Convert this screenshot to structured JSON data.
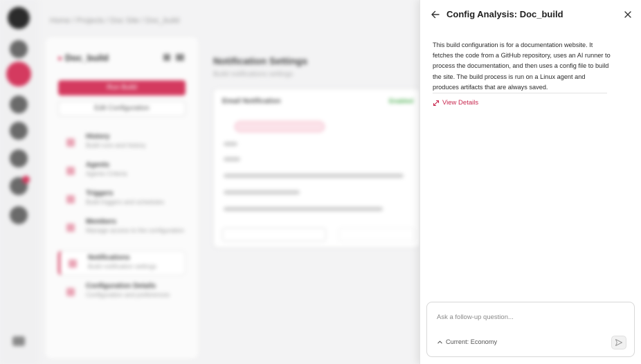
{
  "background": {
    "breadcrumb": "Home / Projects / Doc Site / Doc_build",
    "config_name": "Doc_build",
    "run_button": "Run Build",
    "edit_button": "Edit Configuration",
    "nav": [
      {
        "title": "History",
        "sub": "Build runs and history"
      },
      {
        "title": "Agents",
        "sub": "Agents Criteria"
      },
      {
        "title": "Triggers",
        "sub": "Build triggers and schedules"
      },
      {
        "title": "Members",
        "sub": "Manage access to the configuration"
      },
      {
        "title": "Notifications",
        "sub": "Build notification settings"
      },
      {
        "title": "Configuration Details",
        "sub": "Configuration and preferences"
      }
    ],
    "main_title": "Notification Settings",
    "main_subtitle": "Build notifications settings",
    "card_title": "Email Notification",
    "card_status": "Enabled"
  },
  "panel": {
    "title": "Config Analysis: Doc_build",
    "summary": "This build configuration is for a documentation website. It fetches the code from a GitHub repository, uses an AI runner to process the documentation, and then uses a config file to build the site. The build process is run on a Linux agent and produces artifacts that are always saved.",
    "view_details": "View Details",
    "ask_placeholder": "Ask a follow-up question...",
    "model_label": "Current: Economy"
  },
  "colors": {
    "accent": "#c8284f"
  }
}
